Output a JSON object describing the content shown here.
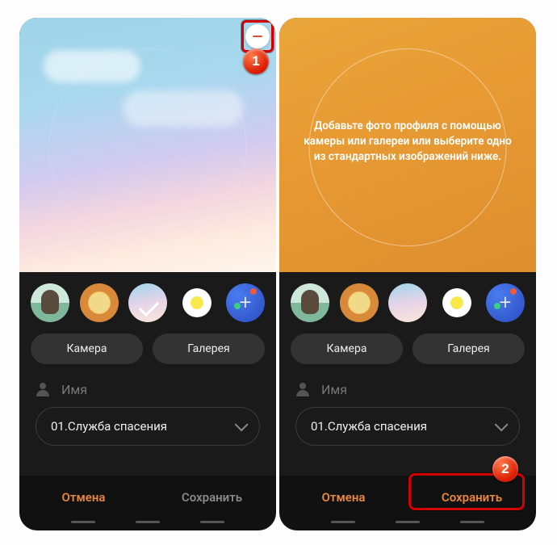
{
  "annotations": {
    "step1": "1",
    "step2": "2"
  },
  "left": {
    "avatars": [
      "alpaca",
      "lion",
      "sky-selected",
      "flower",
      "plus"
    ],
    "buttons": {
      "camera": "Камера",
      "gallery": "Галерея"
    },
    "nameLabel": "Имя",
    "dropdown": {
      "value": "01.Служба спасения"
    },
    "footer": {
      "cancel": "Отмена",
      "save": "Сохранить"
    }
  },
  "right": {
    "previewText": "Добавьте фото профиля с помощью камеры или галереи или выберите одно из стандартных изображений ниже.",
    "avatars": [
      "alpaca",
      "lion",
      "sky",
      "flower",
      "plus"
    ],
    "buttons": {
      "camera": "Камера",
      "gallery": "Галерея"
    },
    "nameLabel": "Имя",
    "dropdown": {
      "value": "01.Служба спасения"
    },
    "footer": {
      "cancel": "Отмена",
      "save": "Сохранить"
    }
  }
}
